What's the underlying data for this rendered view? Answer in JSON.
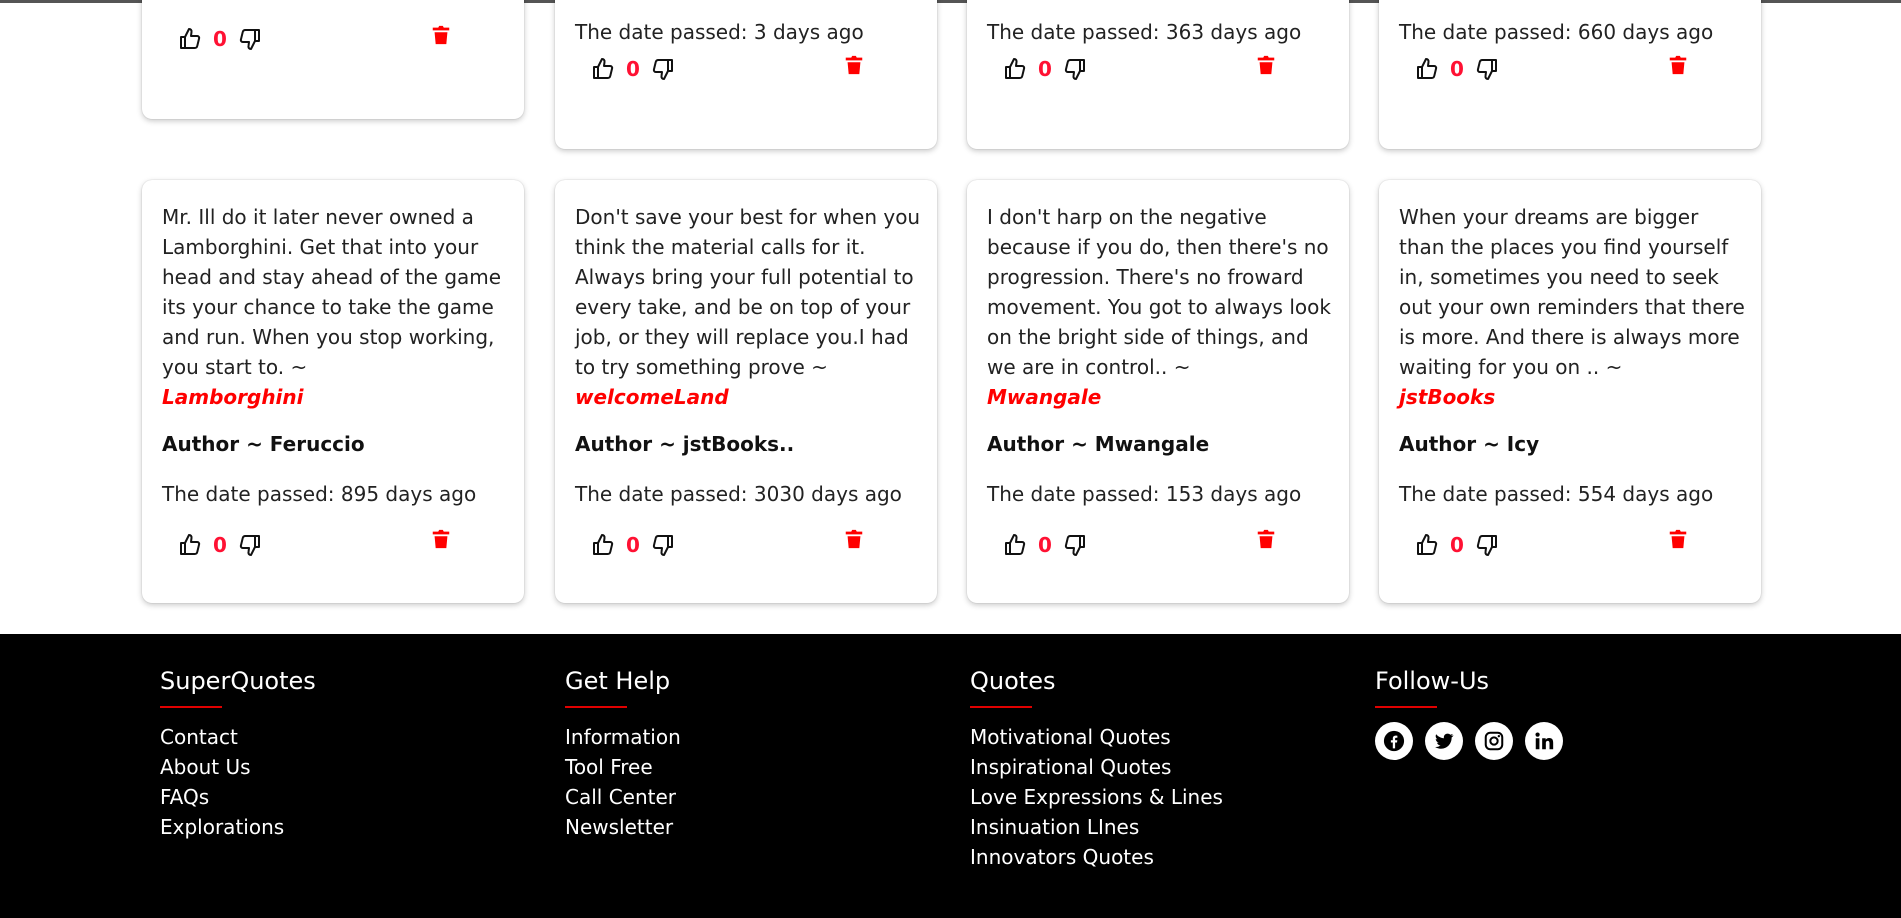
{
  "top_row": [
    {
      "date": "",
      "likes": "0"
    },
    {
      "date": "The date passed: 3 days ago",
      "likes": "0"
    },
    {
      "date": "The date passed: 363 days ago",
      "likes": "0"
    },
    {
      "date": "The date passed: 660 days ago",
      "likes": "0"
    }
  ],
  "cards": [
    {
      "text": "Mr. Ill do it later never owned a Lamborghini. Get that into your head and stay ahead of the game its your chance to take the game and run. When you stop working, you start to. ~",
      "tag": "Lamborghini",
      "author": "Author ~ Feruccio",
      "date": "The date passed: 895 days ago",
      "likes": "0"
    },
    {
      "text": "Don't save your best for when you think the material calls for it. Always bring your full potential to every take, and be on top of your job, or they will replace you.I had to try something prove ~",
      "tag": "welcomeLand",
      "author": "Author ~ jstBooks..",
      "date": "The date passed: 3030 days ago",
      "likes": "0"
    },
    {
      "text": "I don't harp on the negative because if you do, then there's no progression. There's no froward movement. You got to always look on the bright side of things, and we are in control.. ~",
      "tag": "Mwangale",
      "author": "Author ~ Mwangale",
      "date": "The date passed: 153 days ago",
      "likes": "0"
    },
    {
      "text": "When your dreams are bigger than the places you find yourself in, sometimes you need to seek out your own reminders that there is more. And there is always more waiting for you on .. ~",
      "tag": "jstBooks",
      "author": "Author ~ Icy",
      "date": "The date passed: 554 days ago",
      "likes": "0"
    }
  ],
  "footer": {
    "superquotes": {
      "title": "SuperQuotes",
      "links": [
        "Contact",
        "About Us",
        "FAQs",
        "Explorations"
      ]
    },
    "help": {
      "title": "Get Help",
      "links": [
        "Information",
        "Tool Free",
        "Call Center",
        "Newsletter"
      ]
    },
    "quotes": {
      "title": "Quotes",
      "links": [
        "Motivational Quotes",
        "Inspirational Quotes",
        "Love Expressions & Lines",
        "Insinuation LInes",
        "Innovators Quotes"
      ]
    },
    "follow": {
      "title": "Follow-Us",
      "icons": [
        "facebook-icon",
        "twitter-icon",
        "instagram-icon",
        "linkedin-icon"
      ]
    }
  },
  "colors": {
    "accent": "#ff0000",
    "count": "#ff1133",
    "footer_bg": "#000000"
  }
}
